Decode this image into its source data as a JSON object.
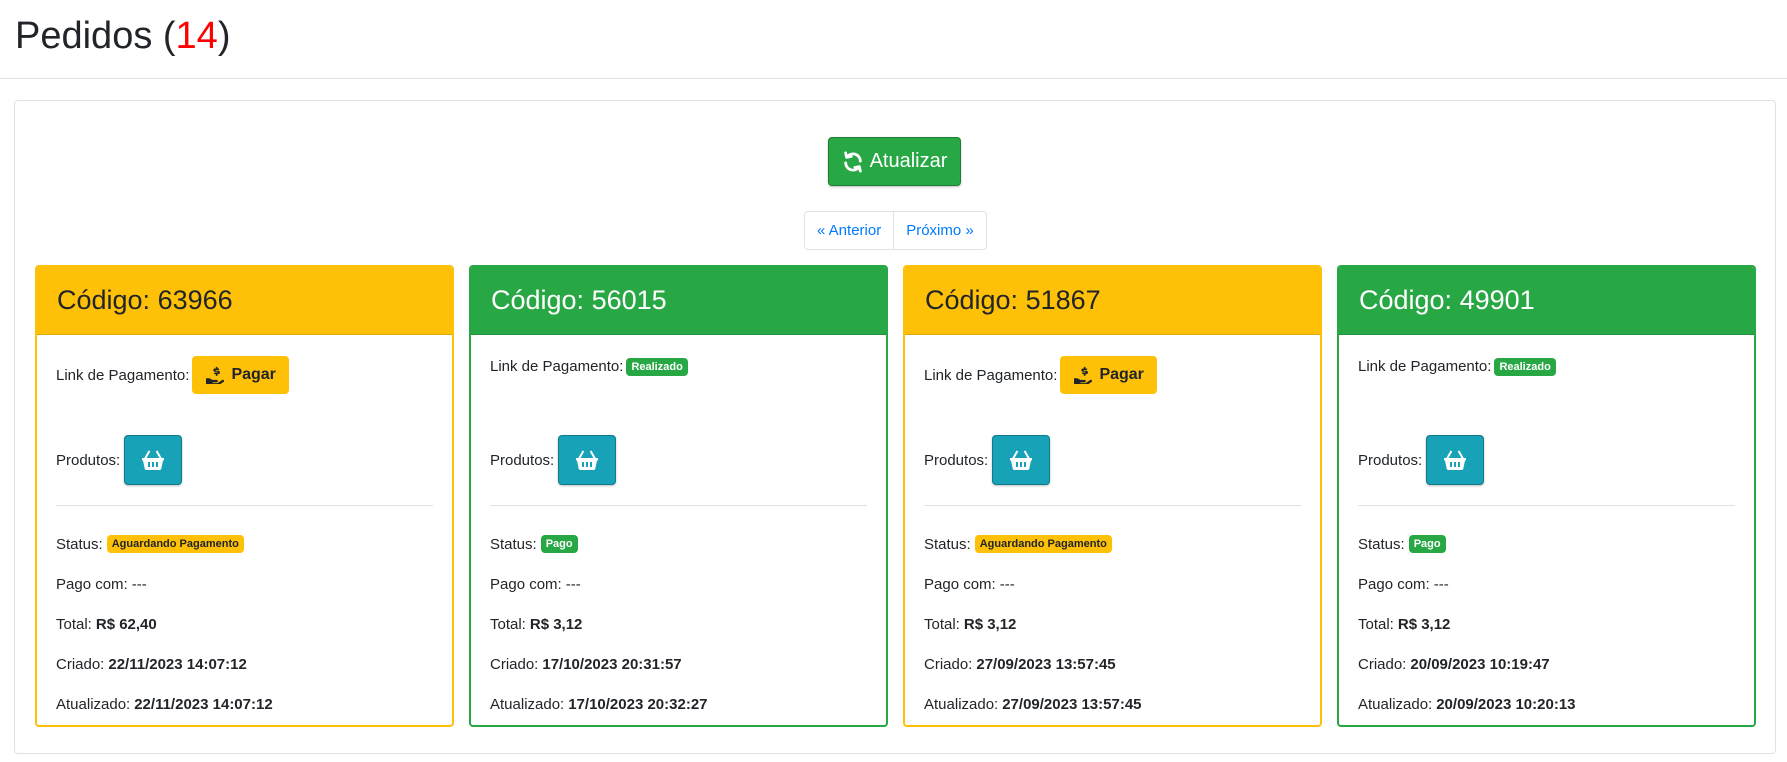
{
  "header": {
    "title": "Pedidos",
    "count": "14"
  },
  "toolbar": {
    "refresh_label": "Atualizar"
  },
  "pagination": {
    "prev_label": "« Anterior",
    "next_label": "Próximo »"
  },
  "labels": {
    "payment_link": "Link de Pagamento:",
    "pay_button": "Pagar",
    "products": "Produtos:",
    "status": "Status:",
    "paid_with": "Pago com:",
    "total": "Total:",
    "created": "Criado:",
    "updated": "Atualizado:"
  },
  "colors": {
    "warning": "#ffc107",
    "success": "#28a745",
    "info": "#17a2b8",
    "count": "#ff0000"
  },
  "orders": [
    {
      "code": "Código: 63966",
      "payment_state": "pending",
      "payment_badge": "",
      "status_badge": "Aguardando Pagamento",
      "paid_with": "---",
      "total": "R$ 62,40",
      "created": "22/11/2023 14:07:12",
      "updated": "22/11/2023 14:07:12"
    },
    {
      "code": "Código: 56015",
      "payment_state": "done",
      "payment_badge": "Realizado",
      "status_badge": "Pago",
      "paid_with": "---",
      "total": "R$ 3,12",
      "created": "17/10/2023 20:31:57",
      "updated": "17/10/2023 20:32:27"
    },
    {
      "code": "Código: 51867",
      "payment_state": "pending",
      "payment_badge": "",
      "status_badge": "Aguardando Pagamento",
      "paid_with": "---",
      "total": "R$ 3,12",
      "created": "27/09/2023 13:57:45",
      "updated": "27/09/2023 13:57:45"
    },
    {
      "code": "Código: 49901",
      "payment_state": "done",
      "payment_badge": "Realizado",
      "status_badge": "Pago",
      "paid_with": "---",
      "total": "R$ 3,12",
      "created": "20/09/2023 10:19:47",
      "updated": "20/09/2023 10:20:13"
    }
  ]
}
